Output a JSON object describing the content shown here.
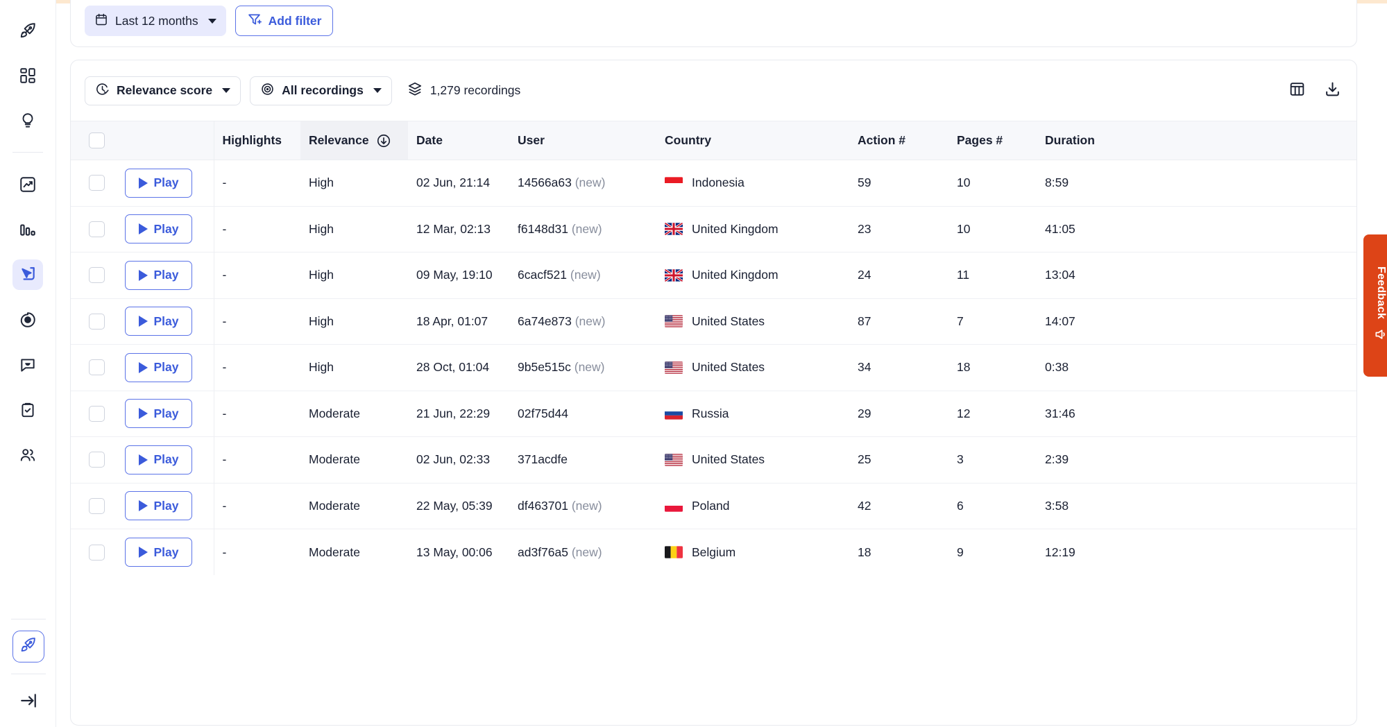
{
  "sidebar": {
    "items": [
      {
        "icon": "rocket-icon",
        "name": "sidebar-item-get-started",
        "active": false
      },
      {
        "icon": "dashboard-grid-icon",
        "name": "sidebar-item-dashboards",
        "active": false
      },
      {
        "icon": "lightbulb-icon",
        "name": "sidebar-item-insights",
        "active": false
      },
      {
        "icon": "trend-chart-icon",
        "name": "sidebar-item-analytics",
        "active": false
      },
      {
        "icon": "bar-chart-icon",
        "name": "sidebar-item-funnels",
        "active": false
      },
      {
        "icon": "cursor-recording-icon",
        "name": "sidebar-item-recordings",
        "active": true
      },
      {
        "icon": "heatmap-target-icon",
        "name": "sidebar-item-heatmaps",
        "active": false
      },
      {
        "icon": "chat-bubble-icon",
        "name": "sidebar-item-feedback",
        "active": false
      },
      {
        "icon": "clipboard-check-icon",
        "name": "sidebar-item-surveys",
        "active": false
      },
      {
        "icon": "users-icon",
        "name": "sidebar-item-users",
        "active": false
      }
    ],
    "cta_icon": "rocket-icon",
    "collapse_icon": "collapse-panel-arrow-icon"
  },
  "filter_bar": {
    "date_range_label": "Last 12 months",
    "date_icon": "calendar-icon",
    "add_filter_label": "Add filter",
    "add_filter_icon": "filter-plus-icon"
  },
  "toolbar": {
    "sort_label": "Relevance score",
    "sort_icon": "relevance-score-icon",
    "recordings_filter_label": "All recordings",
    "recordings_filter_icon": "eye-target-icon",
    "count_label": "1,279 recordings",
    "count_icon": "layers-icon",
    "columns_icon": "table-columns-icon",
    "download_icon": "download-icon"
  },
  "table": {
    "columns": [
      {
        "key": "check",
        "label": ""
      },
      {
        "key": "play",
        "label": ""
      },
      {
        "key": "highlights",
        "label": "Highlights"
      },
      {
        "key": "relevance",
        "label": "Relevance",
        "sorted": true,
        "sort_icon": "sort-descending-icon"
      },
      {
        "key": "date",
        "label": "Date"
      },
      {
        "key": "user",
        "label": "User"
      },
      {
        "key": "country",
        "label": "Country"
      },
      {
        "key": "actions",
        "label": "Action #"
      },
      {
        "key": "pages",
        "label": "Pages #"
      },
      {
        "key": "duration",
        "label": "Duration"
      }
    ],
    "play_label": "Play",
    "new_tag": "(new)",
    "rows": [
      {
        "highlights": "-",
        "relevance": "High",
        "date": "02 Jun, 21:14",
        "user": "14566a63",
        "is_new": true,
        "country": "Indonesia",
        "flag": "id",
        "actions": "59",
        "pages": "10",
        "duration": "8:59"
      },
      {
        "highlights": "-",
        "relevance": "High",
        "date": "12 Mar, 02:13",
        "user": "f6148d31",
        "is_new": true,
        "country": "United Kingdom",
        "flag": "gb",
        "actions": "23",
        "pages": "10",
        "duration": "41:05"
      },
      {
        "highlights": "-",
        "relevance": "High",
        "date": "09 May, 19:10",
        "user": "6cacf521",
        "is_new": true,
        "country": "United Kingdom",
        "flag": "gb",
        "actions": "24",
        "pages": "11",
        "duration": "13:04"
      },
      {
        "highlights": "-",
        "relevance": "High",
        "date": "18 Apr, 01:07",
        "user": "6a74e873",
        "is_new": true,
        "country": "United States",
        "flag": "us",
        "actions": "87",
        "pages": "7",
        "duration": "14:07"
      },
      {
        "highlights": "-",
        "relevance": "High",
        "date": "28 Oct, 01:04",
        "user": "9b5e515c",
        "is_new": true,
        "country": "United States",
        "flag": "us",
        "actions": "34",
        "pages": "18",
        "duration": "0:38"
      },
      {
        "highlights": "-",
        "relevance": "Moderate",
        "date": "21 Jun, 22:29",
        "user": "02f75d44",
        "is_new": false,
        "country": "Russia",
        "flag": "ru",
        "actions": "29",
        "pages": "12",
        "duration": "31:46"
      },
      {
        "highlights": "-",
        "relevance": "Moderate",
        "date": "02 Jun, 02:33",
        "user": "371acdfe",
        "is_new": false,
        "country": "United States",
        "flag": "us",
        "actions": "25",
        "pages": "3",
        "duration": "2:39"
      },
      {
        "highlights": "-",
        "relevance": "Moderate",
        "date": "22 May, 05:39",
        "user": "df463701",
        "is_new": true,
        "country": "Poland",
        "flag": "pl",
        "actions": "42",
        "pages": "6",
        "duration": "3:58"
      },
      {
        "highlights": "-",
        "relevance": "Moderate",
        "date": "13 May, 00:06",
        "user": "ad3f76a5",
        "is_new": true,
        "country": "Belgium",
        "flag": "be",
        "actions": "18",
        "pages": "9",
        "duration": "12:19"
      }
    ]
  },
  "edge_tab": {
    "label": "Feedback",
    "icon": "megaphone-icon",
    "color": "#dd4417"
  },
  "colors": {
    "accent": "#3b5bdb",
    "accent_soft": "#e8eafd",
    "header_bg": "#f7f8fb",
    "sorted_col_bg": "#f0f1f5",
    "border": "#e8eaef",
    "text": "#1a2032",
    "muted": "#878d9c"
  }
}
